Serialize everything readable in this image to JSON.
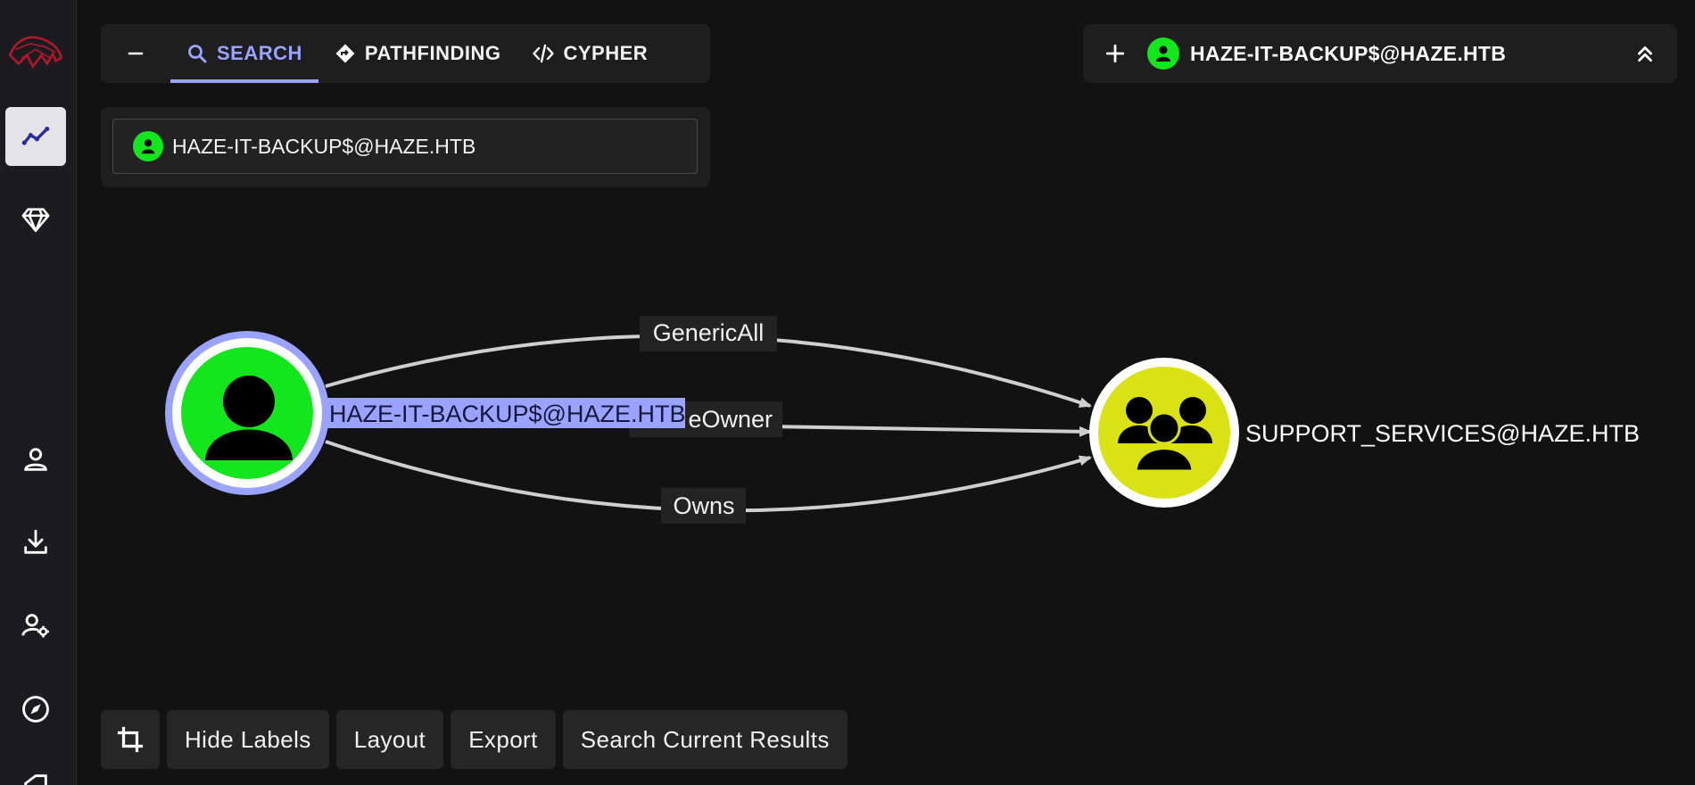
{
  "sidebar": {
    "items": [
      {
        "icon": "app-logo-icon",
        "active": false
      },
      {
        "icon": "explore-graph-icon",
        "active": true
      },
      {
        "icon": "diamond-icon",
        "active": false
      },
      {
        "icon": "user-icon",
        "active": false
      },
      {
        "icon": "download-icon",
        "active": false
      },
      {
        "icon": "user-settings-icon",
        "active": false
      },
      {
        "icon": "compass-icon",
        "active": false
      }
    ]
  },
  "tabs": {
    "collapse_icon": "minus-icon",
    "items": [
      {
        "label": "SEARCH",
        "icon": "search-icon",
        "active": true
      },
      {
        "label": "PATHFINDING",
        "icon": "route-icon",
        "active": false
      },
      {
        "label": "CYPHER",
        "icon": "code-icon",
        "active": false
      }
    ]
  },
  "search": {
    "value": "HAZE-IT-BACKUP$@HAZE.HTB"
  },
  "selected_node": {
    "name": "HAZE-IT-BACKUP$@HAZE.HTB"
  },
  "graph": {
    "nodes": [
      {
        "label": "HAZE-IT-BACKUP$@HAZE.HTB",
        "kind": "user",
        "color": "#14e61e",
        "selected": true
      },
      {
        "label": "SUPPORT_SERVICES@HAZE.HTB",
        "kind": "group",
        "color": "#dbe214",
        "selected": false
      }
    ],
    "edges": [
      {
        "label": "GenericAll"
      },
      {
        "label": "eOwner"
      },
      {
        "label": "Owns"
      }
    ],
    "selection_color": "#9aa3ff"
  },
  "toolbar": {
    "buttons": [
      {
        "label": "Hide Labels"
      },
      {
        "label": "Layout"
      },
      {
        "label": "Export"
      },
      {
        "label": "Search Current Results"
      }
    ]
  }
}
